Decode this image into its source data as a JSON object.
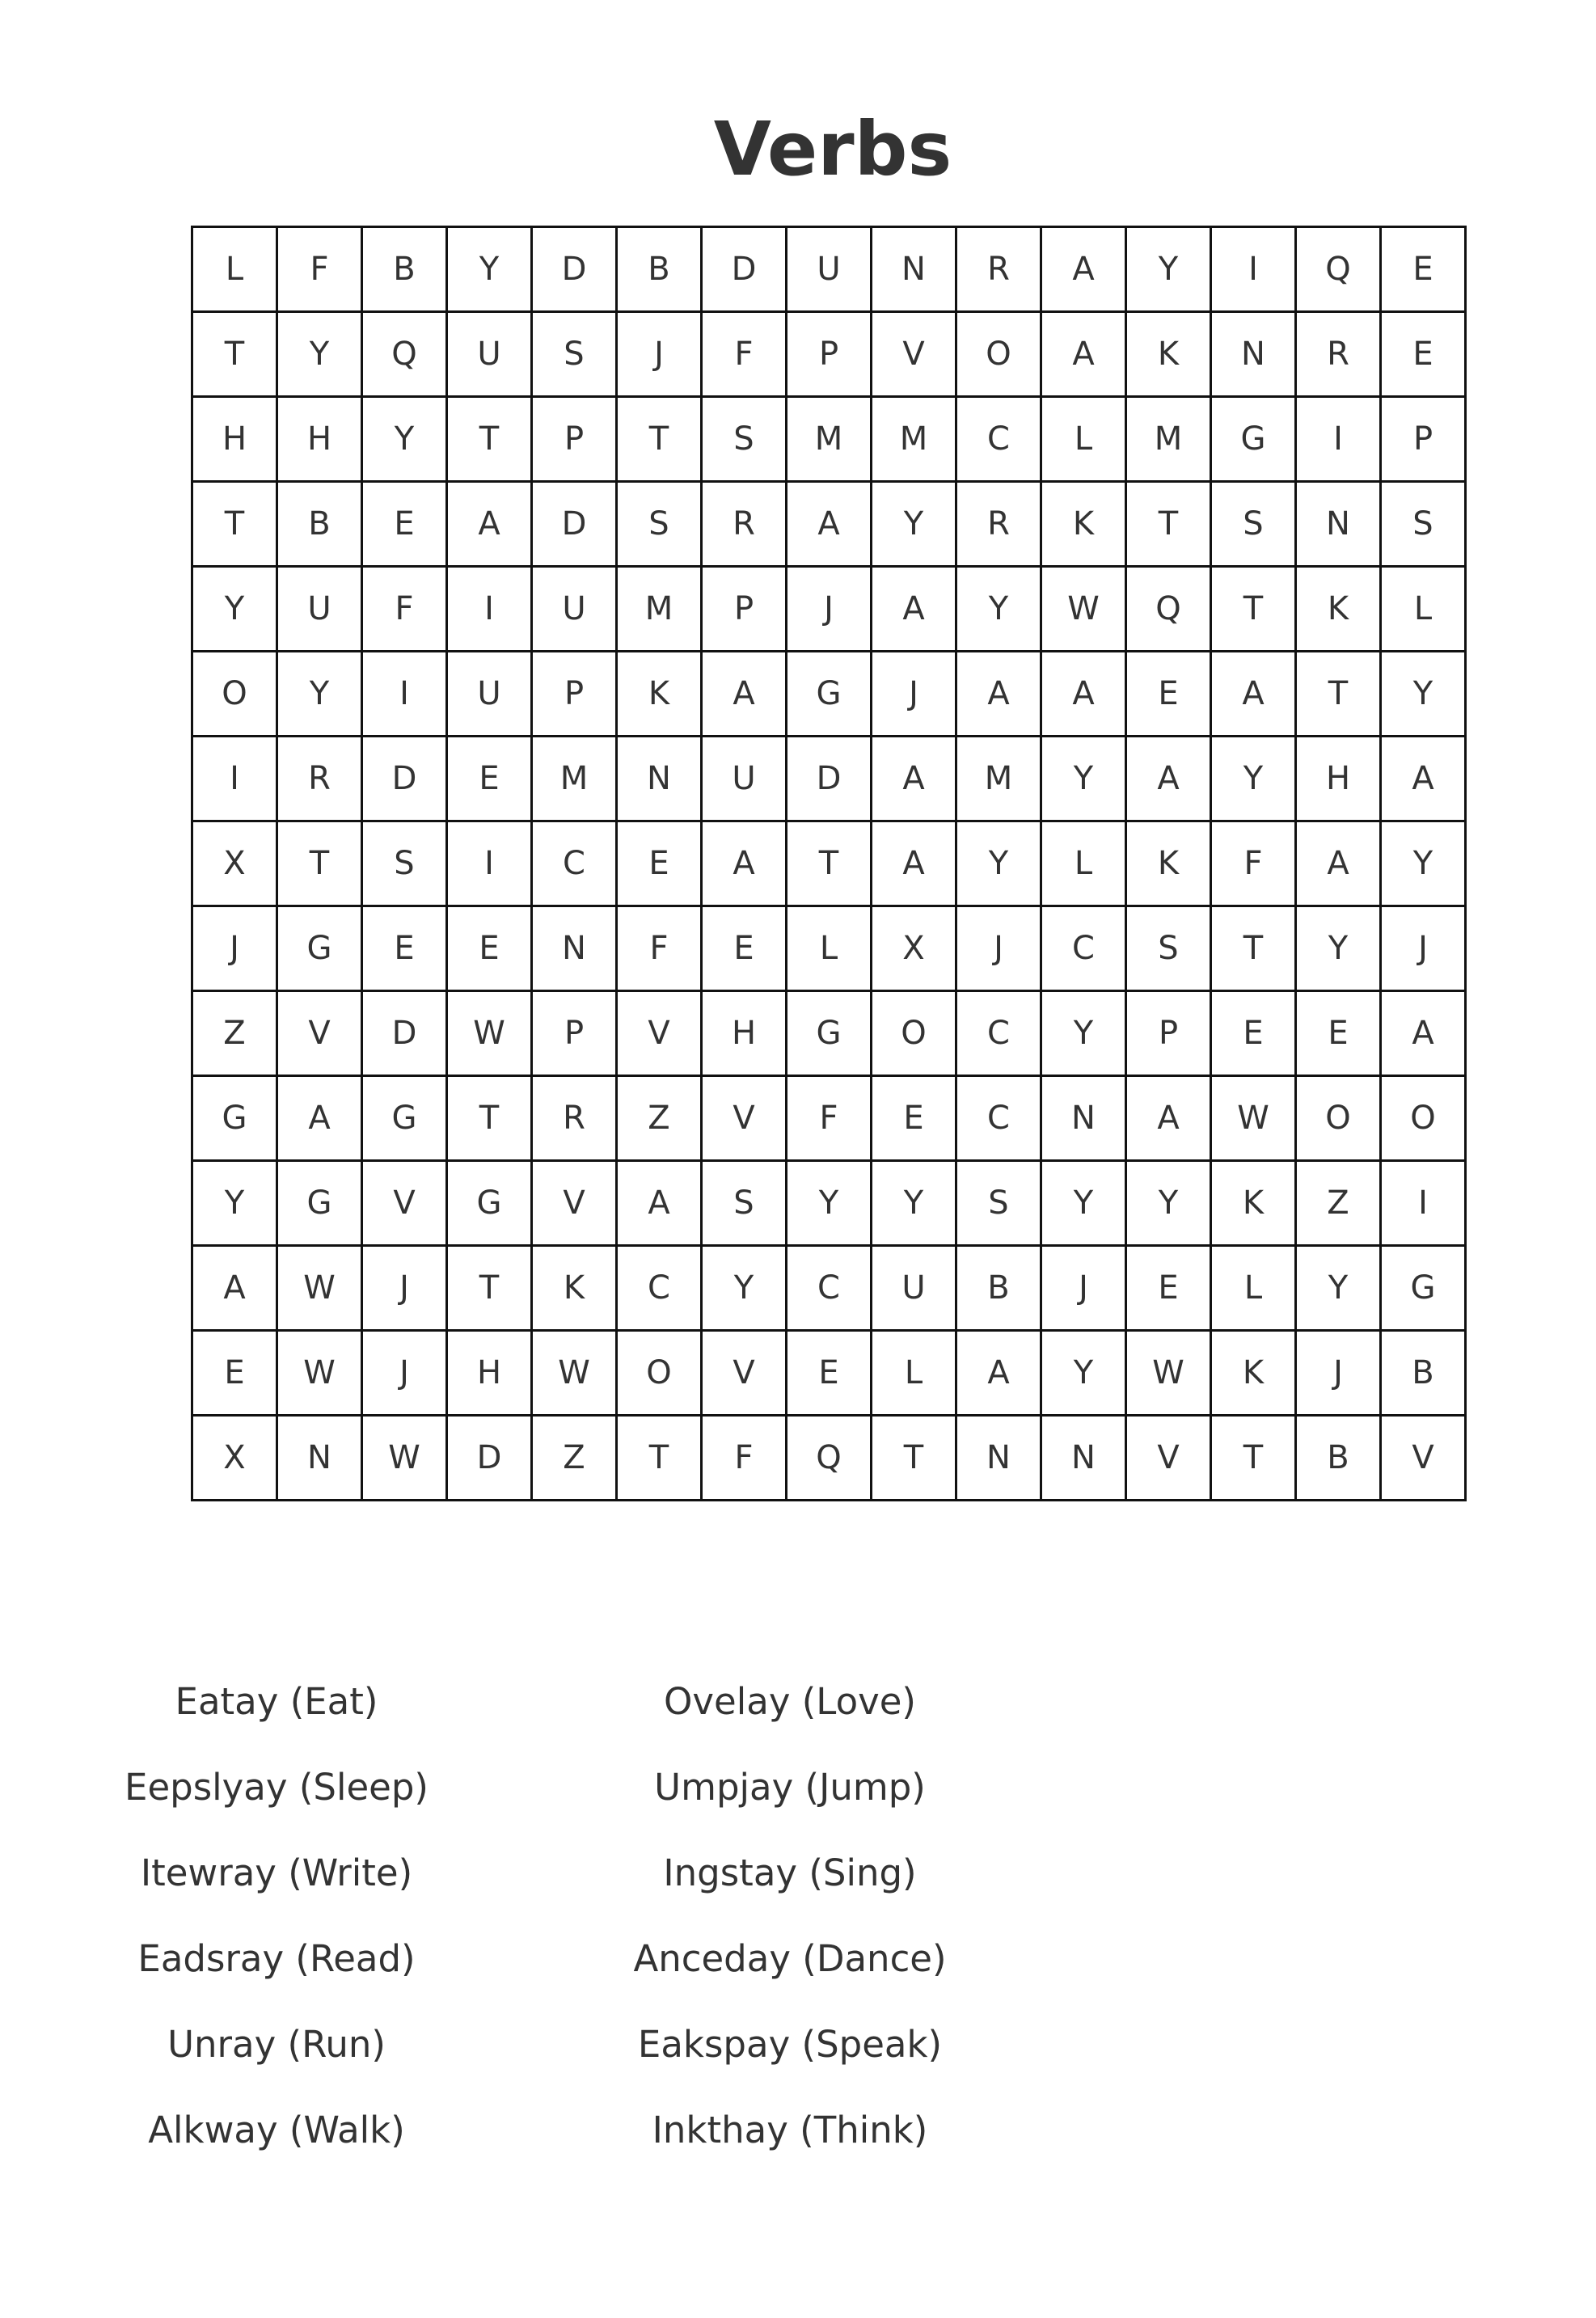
{
  "title": "Verbs",
  "grid": [
    [
      "L",
      "F",
      "B",
      "Y",
      "D",
      "B",
      "D",
      "U",
      "N",
      "R",
      "A",
      "Y",
      "I",
      "Q",
      "E"
    ],
    [
      "T",
      "Y",
      "Q",
      "U",
      "S",
      "J",
      "F",
      "P",
      "V",
      "O",
      "A",
      "K",
      "N",
      "R",
      "E"
    ],
    [
      "H",
      "H",
      "Y",
      "T",
      "P",
      "T",
      "S",
      "M",
      "M",
      "C",
      "L",
      "M",
      "G",
      "I",
      "P"
    ],
    [
      "T",
      "B",
      "E",
      "A",
      "D",
      "S",
      "R",
      "A",
      "Y",
      "R",
      "K",
      "T",
      "S",
      "N",
      "S"
    ],
    [
      "Y",
      "U",
      "F",
      "I",
      "U",
      "M",
      "P",
      "J",
      "A",
      "Y",
      "W",
      "Q",
      "T",
      "K",
      "L"
    ],
    [
      "O",
      "Y",
      "I",
      "U",
      "P",
      "K",
      "A",
      "G",
      "J",
      "A",
      "A",
      "E",
      "A",
      "T",
      "Y"
    ],
    [
      "I",
      "R",
      "D",
      "E",
      "M",
      "N",
      "U",
      "D",
      "A",
      "M",
      "Y",
      "A",
      "Y",
      "H",
      "A"
    ],
    [
      "X",
      "T",
      "S",
      "I",
      "C",
      "E",
      "A",
      "T",
      "A",
      "Y",
      "L",
      "K",
      "F",
      "A",
      "Y"
    ],
    [
      "J",
      "G",
      "E",
      "E",
      "N",
      "F",
      "E",
      "L",
      "X",
      "J",
      "C",
      "S",
      "T",
      "Y",
      "J"
    ],
    [
      "Z",
      "V",
      "D",
      "W",
      "P",
      "V",
      "H",
      "G",
      "O",
      "C",
      "Y",
      "P",
      "E",
      "E",
      "A"
    ],
    [
      "G",
      "A",
      "G",
      "T",
      "R",
      "Z",
      "V",
      "F",
      "E",
      "C",
      "N",
      "A",
      "W",
      "O",
      "O"
    ],
    [
      "Y",
      "G",
      "V",
      "G",
      "V",
      "A",
      "S",
      "Y",
      "Y",
      "S",
      "Y",
      "Y",
      "K",
      "Z",
      "I"
    ],
    [
      "A",
      "W",
      "J",
      "T",
      "K",
      "C",
      "Y",
      "C",
      "U",
      "B",
      "J",
      "E",
      "L",
      "Y",
      "G"
    ],
    [
      "E",
      "W",
      "J",
      "H",
      "W",
      "O",
      "V",
      "E",
      "L",
      "A",
      "Y",
      "W",
      "K",
      "J",
      "B"
    ],
    [
      "X",
      "N",
      "W",
      "D",
      "Z",
      "T",
      "F",
      "Q",
      "T",
      "N",
      "N",
      "V",
      "T",
      "B",
      "V"
    ]
  ],
  "word_columns": [
    [
      "Eatay (Eat)",
      "Eepslyay (Sleep)",
      "Itewray (Write)",
      "Eadsray (Read)",
      "Unray (Run)",
      "Alkway (Walk)"
    ],
    [
      "Ovelay (Love)",
      "Umpjay (Jump)",
      "Ingstay (Sing)",
      "Anceday (Dance)",
      "Eakspay (Speak)",
      "Inkthay (Think)"
    ]
  ]
}
